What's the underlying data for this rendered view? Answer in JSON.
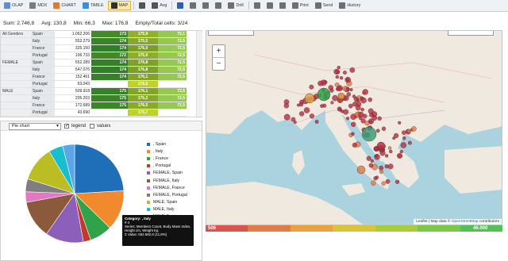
{
  "toolbar": {
    "items": [
      {
        "label": "OLAP",
        "icon": "cube-icon",
        "color": "#5b8fd1"
      },
      {
        "label": "MDX",
        "icon": "code-icon",
        "color": "#7b7b7b"
      },
      {
        "label": "CHART",
        "icon": "chart-icon",
        "color": "#e07b2a"
      },
      {
        "label": "TABLE",
        "icon": "table-icon",
        "color": "#3f8fd8"
      },
      {
        "label": "MAP",
        "icon": "map-icon",
        "color": "#2f2f2f"
      },
      {
        "label": "",
        "icon": "sum-icon",
        "color": "#555555"
      },
      {
        "label": "Avg",
        "icon": "avg-icon",
        "color": "#555555"
      },
      {
        "label": "",
        "icon": "funnel-icon",
        "color": "#2f5fa8"
      },
      {
        "label": "",
        "icon": "swap-icon",
        "color": "#6f6f6f"
      },
      {
        "label": "",
        "icon": "filter-icon",
        "color": "#6f6f6f"
      },
      {
        "label": "",
        "icon": "sort-icon",
        "color": "#6f6f6f"
      },
      {
        "label": "Drill",
        "icon": "drill-icon",
        "color": "#6f6f6f"
      },
      {
        "label": "",
        "icon": "pin-icon",
        "color": "#6f6f6f"
      },
      {
        "label": "",
        "icon": "grid-icon",
        "color": "#6f6f6f"
      },
      {
        "label": "",
        "icon": "save-icon",
        "color": "#6f6f6f"
      },
      {
        "label": "Print",
        "icon": "print-icon",
        "color": "#6f6f6f"
      },
      {
        "label": "Send",
        "icon": "send-icon",
        "color": "#6f6f6f"
      },
      {
        "label": "History",
        "icon": "history-icon",
        "color": "#6f6f6f"
      }
    ]
  },
  "stats": {
    "sum": "Sum: 2.746,8",
    "avg": "Avg: 130,8",
    "min": "Min: 66,3",
    "max": "Max: 176,8",
    "empty": "Empty/Total cells: 3/24"
  },
  "pivot": {
    "rows": [
      {
        "group": "All Genders",
        "country": "Spain",
        "value": "1.062.206",
        "c1": "173",
        "c2": "175,9",
        "c3": "72,1",
        "shade": 0.55
      },
      {
        "group": "",
        "country": "Italy",
        "value": "552.279",
        "c1": "174",
        "c2": "175,5",
        "c3": "72,5",
        "shade": 0.7
      },
      {
        "group": "",
        "country": "France",
        "value": "325.150",
        "c1": "174",
        "c2": "176,0",
        "c3": "72,5",
        "shade": 0.85
      },
      {
        "group": "",
        "country": "Portugal",
        "value": "106.733",
        "c1": "172",
        "c2": "175,0",
        "c3": "72,5",
        "shade": 0.6
      },
      {
        "group": "FEMALE",
        "country": "Spain",
        "value": "552.289",
        "c1": "174",
        "c2": "176,8",
        "c3": "72,5",
        "shade": 0.8
      },
      {
        "group": "",
        "country": "Italy",
        "value": "547.076",
        "c1": "174",
        "c2": "176,8",
        "c3": "72,5",
        "shade": 0.82
      },
      {
        "group": "",
        "country": "France",
        "value": "152.461",
        "c1": "174",
        "c2": "176,1",
        "c3": "72,5",
        "shade": 0.75
      },
      {
        "group": "",
        "country": "Portugal",
        "value": "63.043",
        "c1": "",
        "c2": "176,5",
        "c3": "",
        "shade": 0.0
      },
      {
        "group": "MALE",
        "country": "Spain",
        "value": "509.918",
        "c1": "175",
        "c2": "176,1",
        "c3": "72,5",
        "shade": 0.75
      },
      {
        "group": "",
        "country": "Italy",
        "value": "205.203",
        "c1": "175",
        "c2": "176,2",
        "c3": "72,5",
        "shade": 0.7
      },
      {
        "group": "",
        "country": "France",
        "value": "172.689",
        "c1": "175",
        "c2": "176,5",
        "c3": "72,5",
        "shade": 0.65
      },
      {
        "group": "",
        "country": "Portugal",
        "value": "43.690",
        "c1": "",
        "c2": "175,7",
        "c3": "",
        "shade": 0.0
      }
    ]
  },
  "chart_panel": {
    "chart_type": "Pie chart",
    "legend_label": "legend",
    "values_label": "values",
    "legend_checked": true,
    "values_checked": false
  },
  "chart_data": {
    "type": "pie",
    "categories": [
      ", Spain",
      ", Italy",
      ", France",
      ", Portugal",
      "FEMALE, Spain",
      "FEMALE, Italy",
      "FEMALE, France",
      "FEMALE, Portugal",
      "MALE, Spain",
      "MALE, Italy",
      "MALE, France"
    ],
    "values": [
      21.5,
      11.8,
      6.6,
      2.2,
      11.2,
      11.1,
      3.1,
      3.8,
      10.3,
      4.2,
      3.5
    ],
    "colors": [
      "#1f6eb8",
      "#f08a2c",
      "#2fa24a",
      "#c0392b",
      "#8c5fb8",
      "#8b5a3c",
      "#e377c2",
      "#7f7f7f",
      "#bcbd22",
      "#17becf",
      "#5aa6e6"
    ],
    "legend_placement": "right"
  },
  "tooltip": {
    "category": "Category: , Italy",
    "line1": "# 4",
    "line2": "Series: Members Count, Body Mass Index,",
    "line3": "Height cm, Weight Kg",
    "line4": "Σ Value: 552.582,6 (11,8%)"
  },
  "map": {
    "attribution_prefix": "Leaflet | Map data ©",
    "attribution_link": "OpenStreetMap",
    "attribution_suffix": "contributors",
    "zoom_in": "+",
    "zoom_out": "−",
    "scale_min": "506",
    "scale_max": "46.000",
    "scale_colors": [
      "#d9534f",
      "#e07c4a",
      "#e8a23f",
      "#d7c43a",
      "#a9cc3e",
      "#7cc64a",
      "#54bf53"
    ]
  }
}
